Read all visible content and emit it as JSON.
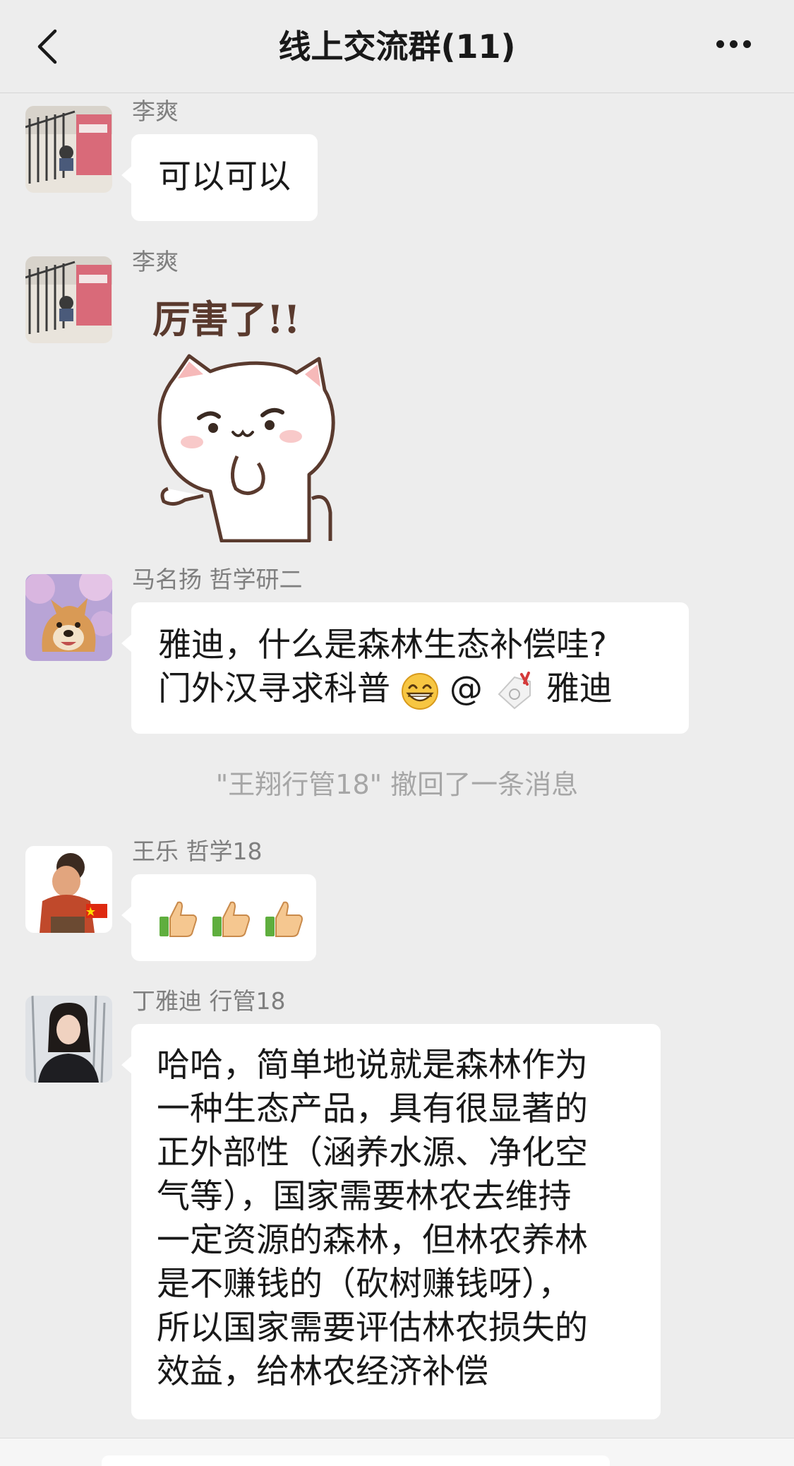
{
  "header": {
    "title": "线上交流群(11)"
  },
  "messages": [
    {
      "sender": "李爽",
      "text": "可以可以"
    },
    {
      "sender": "李爽",
      "sticker_caption": "厉害了!!"
    },
    {
      "sender": "马名扬 哲学研二",
      "lines": [
        "雅迪，什么是森林生态补偿哇?",
        "门外汉寻求科普",
        "@",
        "雅迪"
      ]
    },
    {
      "sender": "王乐 哲学18",
      "emoji": "👍👍👍"
    },
    {
      "sender": "丁雅迪 行管18",
      "lines": [
        "哈哈，简单地说就是森林作为",
        "一种生态产品，具有很显著的",
        "正外部性（涵养水源、净化空",
        "气等），国家需要林农去维持",
        "一定资源的森林，但林农养林",
        "是不赚钱的（砍树赚钱呀），",
        "所以国家需要评估林农损失的",
        "效益，给林农经济补偿"
      ]
    }
  ],
  "system_message": "\"王翔行管18\" 撤回了一条消息",
  "colors": {
    "background": "#ededed",
    "bubble": "#ffffff",
    "sender_text": "#7f7f7f",
    "system_text": "#a6a6a6"
  }
}
